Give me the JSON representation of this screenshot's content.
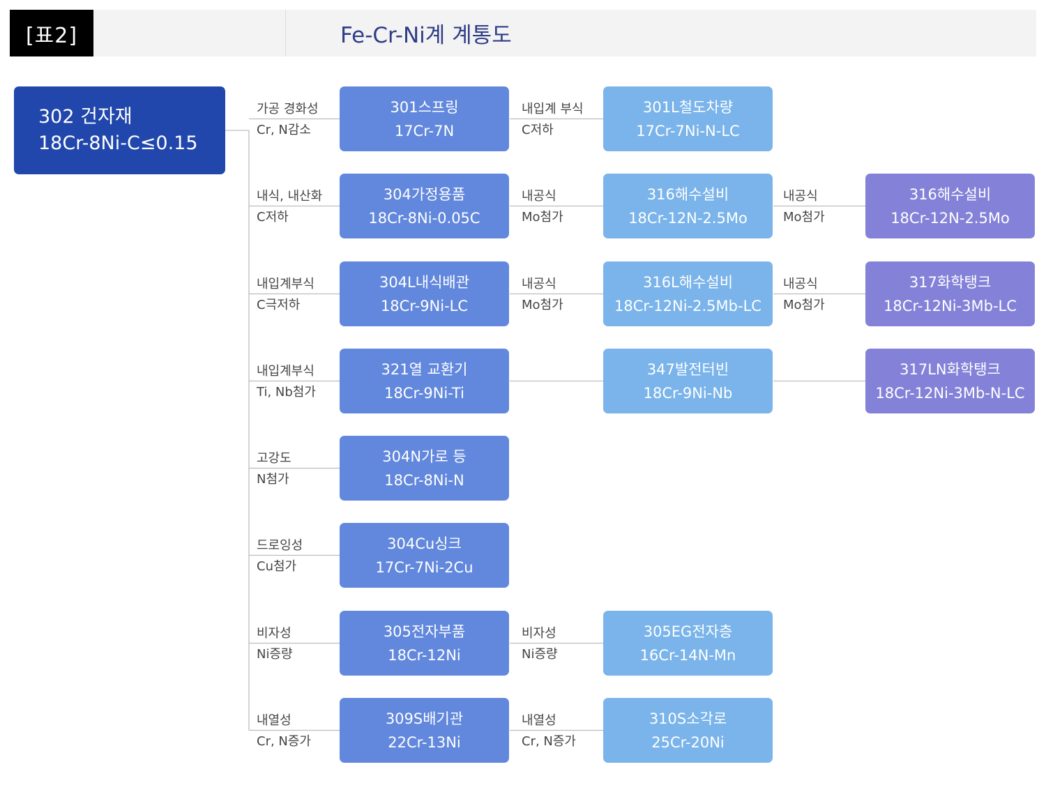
{
  "header": {
    "tag": "[표2]",
    "title": "Fe-Cr-Ni계 계통도"
  },
  "colors": {
    "root": "#2147ac",
    "level1": "#6288dd",
    "level2": "#7ab4ea",
    "level3": "#8482d8",
    "line": "#bdbdbd"
  },
  "root": {
    "line1": "302 건자재",
    "line2": "18Cr-8Ni-C≤0.15"
  },
  "rows": [
    {
      "l1_label": [
        "가공 경화성",
        "Cr, N감소"
      ],
      "l1": [
        "301스프링",
        "17Cr-7N"
      ],
      "l2_label": [
        "내입계 부식",
        "C저하"
      ],
      "l2": [
        "301L철도차량",
        "17Cr-7Ni-N-LC"
      ]
    },
    {
      "l1_label": [
        "내식, 내산화",
        "C저하"
      ],
      "l1": [
        "304가정용품",
        "18Cr-8Ni-0.05C"
      ],
      "l2_label": [
        "내공식",
        "Mo첨가"
      ],
      "l2": [
        "316해수설비",
        "18Cr-12N-2.5Mo"
      ],
      "l3_label": [
        "내공식",
        "Mo첨가"
      ],
      "l3": [
        "316해수설비",
        "18Cr-12N-2.5Mo"
      ]
    },
    {
      "l1_label": [
        "내입계부식",
        "C극저하"
      ],
      "l1": [
        "304L내식배관",
        "18Cr-9Ni-LC"
      ],
      "l2_label": [
        "내공식",
        "Mo첨가"
      ],
      "l2": [
        "316L해수설비",
        "18Cr-12Ni-2.5Mb-LC"
      ],
      "l3_label": [
        "내공식",
        "Mo첨가"
      ],
      "l3": [
        "317화학탱크",
        "18Cr-12Ni-3Mb-LC"
      ]
    },
    {
      "l1_label": [
        "내입계부식",
        "Ti, Nb첨가"
      ],
      "l1": [
        "321열 교환기",
        "18Cr-9Ni-Ti"
      ],
      "l2": [
        "347발전터빈",
        "18Cr-9Ni-Nb"
      ],
      "l3": [
        "317LN화학탱크",
        "18Cr-12Ni-3Mb-N-LC"
      ]
    },
    {
      "l1_label": [
        "고강도",
        "N첨가"
      ],
      "l1": [
        "304N가로 등",
        "18Cr-8Ni-N"
      ]
    },
    {
      "l1_label": [
        "드로잉성",
        "Cu첨가"
      ],
      "l1": [
        "304Cu싱크",
        "17Cr-7Ni-2Cu"
      ]
    },
    {
      "l1_label": [
        "비자성",
        "Ni증량"
      ],
      "l1": [
        "305전자부품",
        "18Cr-12Ni"
      ],
      "l2_label": [
        "비자성",
        "Ni증량"
      ],
      "l2": [
        "305EG전자층",
        "16Cr-14N-Mn"
      ]
    },
    {
      "l1_label": [
        "내열성",
        "Cr, N증가"
      ],
      "l1": [
        "309S배기관",
        "22Cr-13Ni"
      ],
      "l2_label": [
        "내열성",
        "Cr, N증가"
      ],
      "l2": [
        "310S소각로",
        "25Cr-20Ni"
      ]
    }
  ]
}
